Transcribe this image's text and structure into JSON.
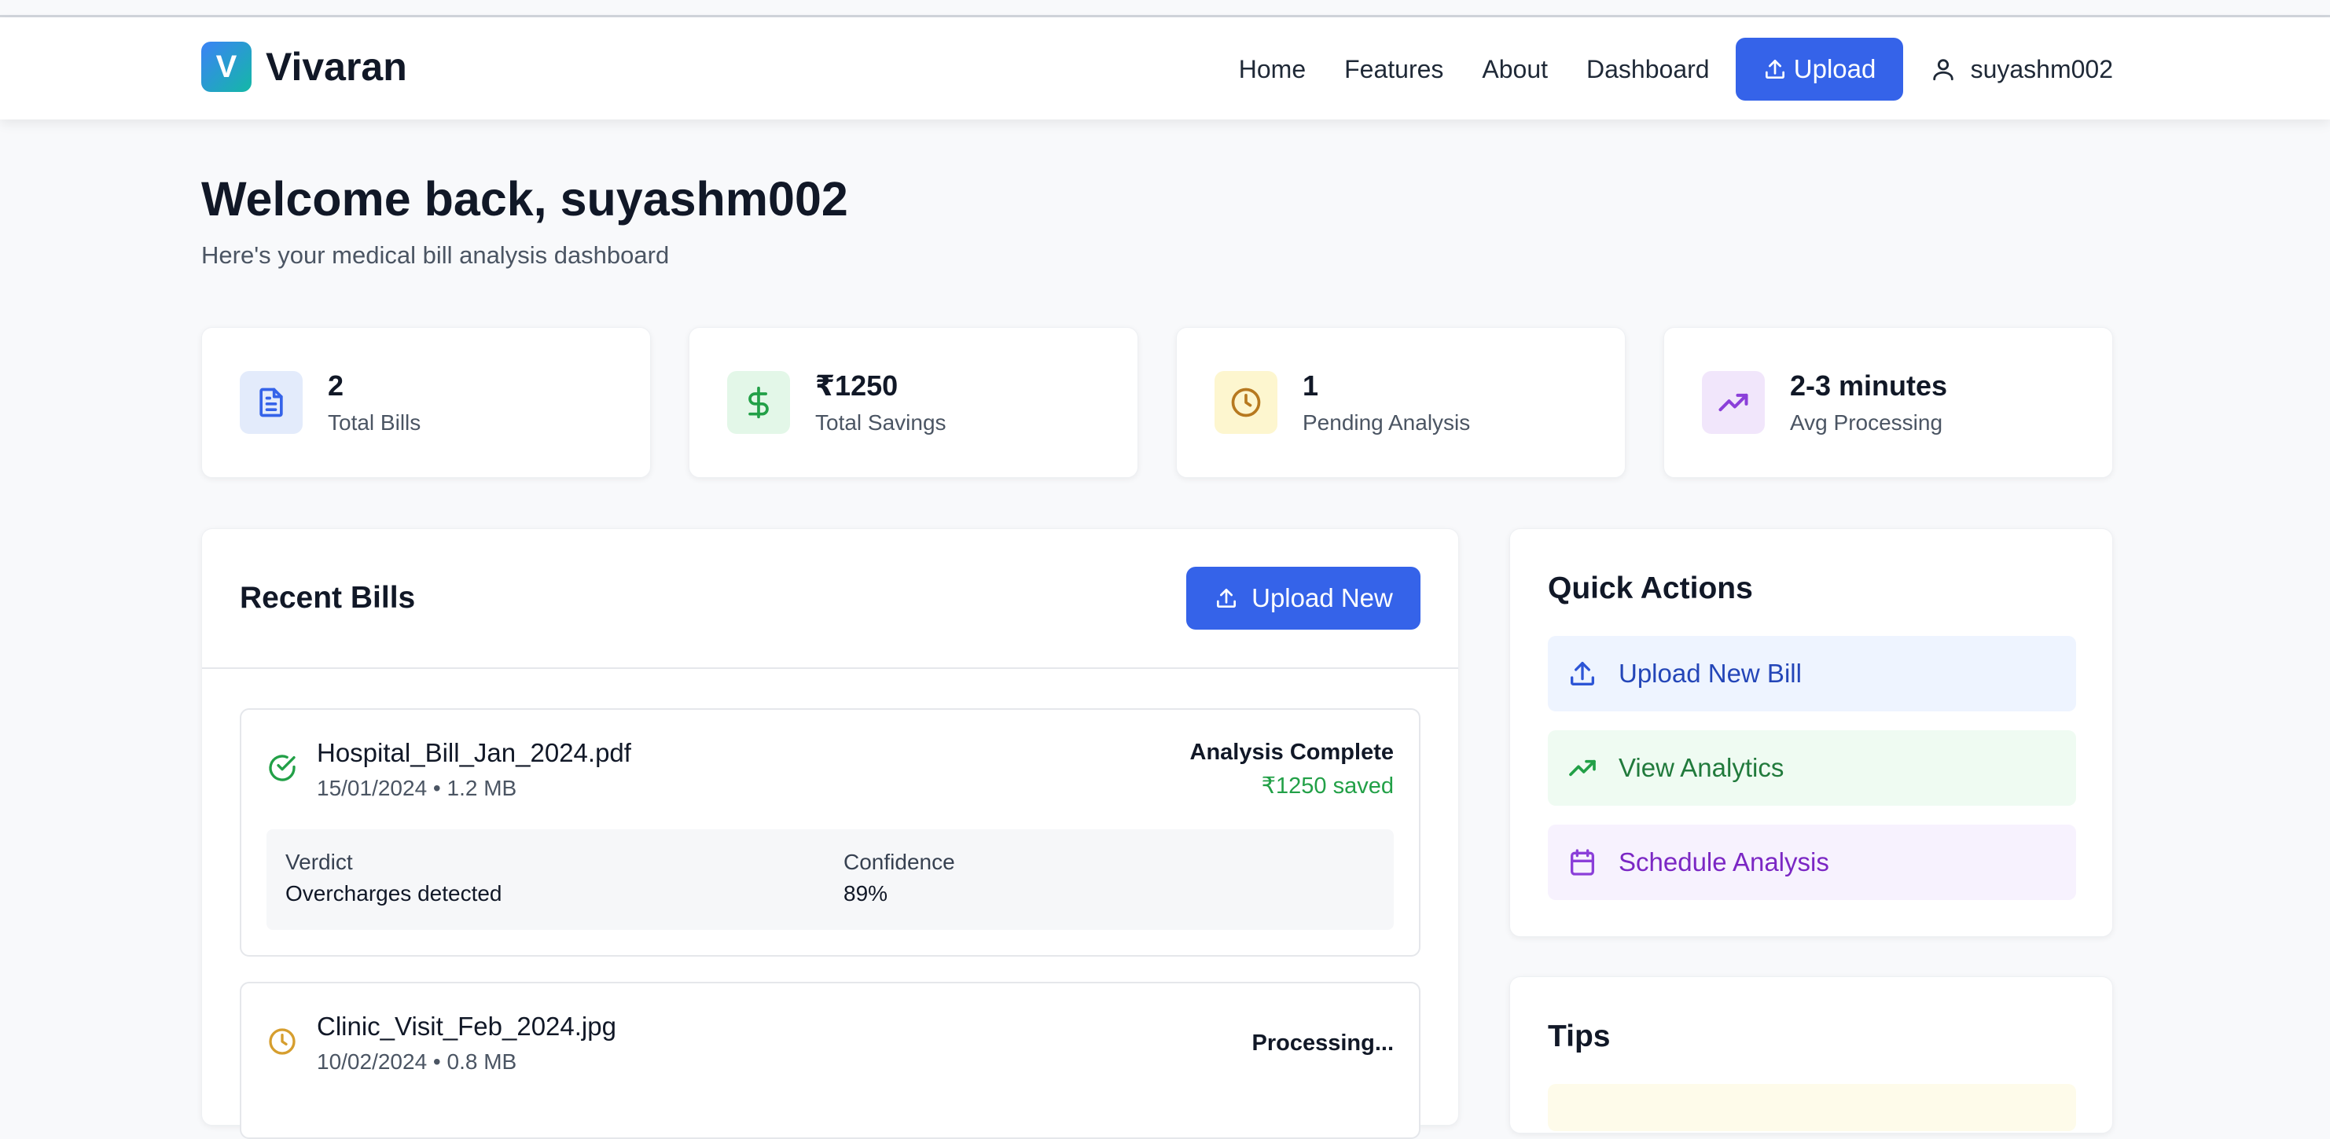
{
  "nav": {
    "logo_letter": "V",
    "brand": "Vivaran",
    "links": [
      "Home",
      "Features",
      "About",
      "Dashboard"
    ],
    "upload_label": "Upload",
    "username": "suyashm002"
  },
  "welcome": {
    "title": "Welcome back, suyashm002",
    "subtitle": "Here's your medical bill analysis dashboard"
  },
  "stats": [
    {
      "value": "2",
      "label": "Total Bills",
      "icon": "document-icon",
      "bg": "#e3ebfb",
      "color": "#3563e9"
    },
    {
      "value": "₹1250",
      "label": "Total Savings",
      "icon": "dollar-icon",
      "bg": "#e3f7e8",
      "color": "#22a047"
    },
    {
      "value": "1",
      "label": "Pending Analysis",
      "icon": "clock-icon",
      "bg": "#fdf6cf",
      "color": "#b7791f"
    },
    {
      "value": "2-3 minutes",
      "label": "Avg Processing",
      "icon": "trending-up-icon",
      "bg": "#f1e6fb",
      "color": "#8b3fd9"
    }
  ],
  "recent": {
    "title": "Recent Bills",
    "upload_new_label": "Upload New",
    "bills": [
      {
        "name": "Hospital_Bill_Jan_2024.pdf",
        "meta": "15/01/2024 • 1.2 MB",
        "status": "Analysis Complete",
        "saved": "₹1250 saved",
        "verdict_label": "Verdict",
        "verdict": "Overcharges detected",
        "confidence_label": "Confidence",
        "confidence": "89%"
      },
      {
        "name": "Clinic_Visit_Feb_2024.jpg",
        "meta": "10/02/2024 • 0.8 MB",
        "status": "Processing..."
      }
    ]
  },
  "quick_actions": {
    "title": "Quick Actions",
    "items": [
      "Upload New Bill",
      "View Analytics",
      "Schedule Analysis"
    ]
  },
  "tips": {
    "title": "Tips"
  }
}
